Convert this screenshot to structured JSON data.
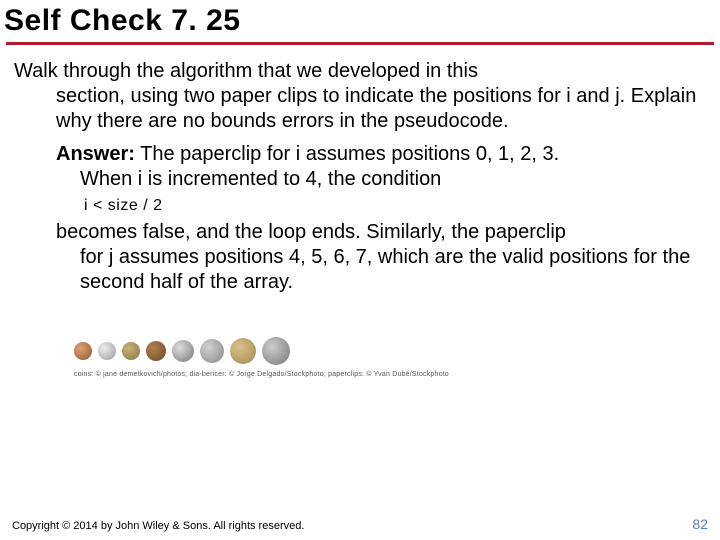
{
  "title": "Self Check 7. 25",
  "question_line1": "Walk through the algorithm that we developed in this",
  "question_rest": "section, using two paper clips to indicate the positions for i and j. Explain why there are no bounds errors in the pseudocode.",
  "answer_label": "Answer:",
  "answer_line1_rest": " The paperclip for i assumes positions 0, 1, 2, 3.",
  "answer_line2": "When i is incremented to 4, the condition",
  "code": "i < size / 2",
  "answer_cont_line1": "becomes false, and the loop ends. Similarly, the paperclip",
  "answer_cont_rest": "for j assumes positions 4, 5, 6, 7, which are the valid positions for the second half of the array.",
  "image_credits": "coins: © jane demetkovich/photos; dia-bericer: © Jorge Delgado/Stockphoto; paperclips: © Yvan Dubé/Stockphoto",
  "copyright": "Copyright © 2014 by John Wiley & Sons. All rights reserved.",
  "page_number": "82"
}
